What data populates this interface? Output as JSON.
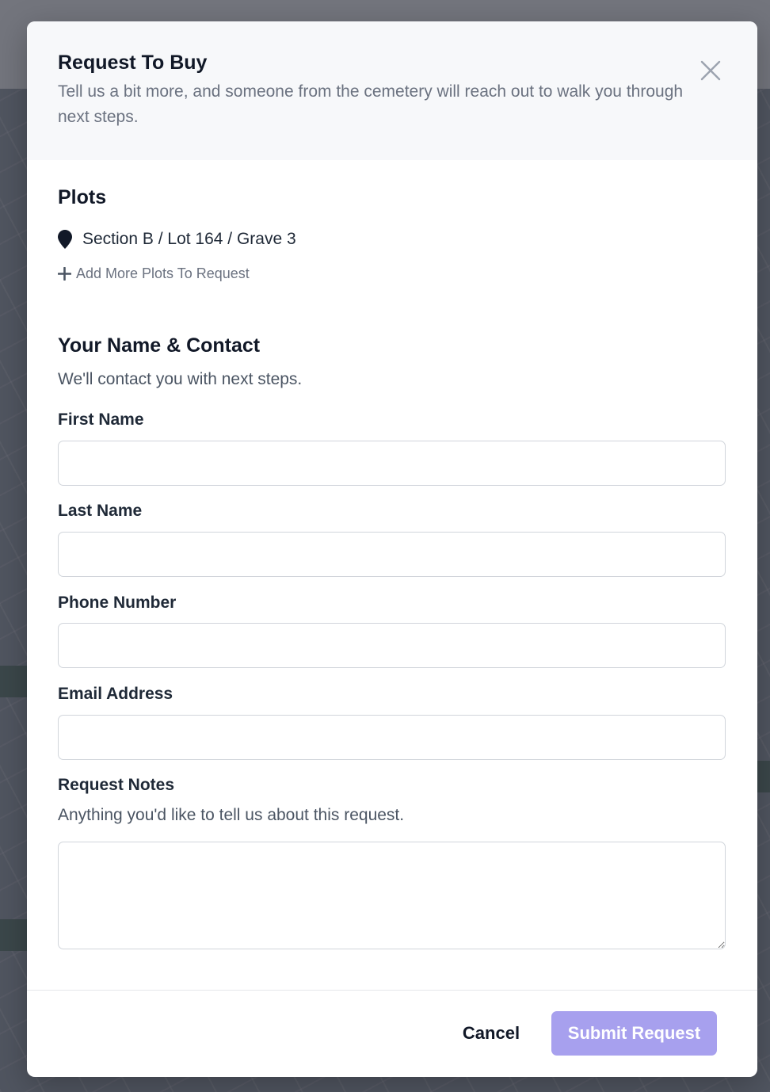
{
  "modal": {
    "title": "Request To Buy",
    "subtitle": "Tell us a bit more, and someone from the cemetery will reach out to walk you through next steps."
  },
  "plots": {
    "heading": "Plots",
    "items": [
      {
        "label": "Section B / Lot 164 / Grave 3",
        "icon": "map-pin-icon"
      }
    ],
    "add_more_label": "Add More Plots To Request"
  },
  "contact": {
    "heading": "Your Name & Contact",
    "help": "We'll contact you with next steps.",
    "first_name": {
      "label": "First Name",
      "value": ""
    },
    "last_name": {
      "label": "Last Name",
      "value": ""
    },
    "phone": {
      "label": "Phone Number",
      "value": ""
    },
    "email": {
      "label": "Email Address",
      "value": ""
    }
  },
  "notes": {
    "label": "Request Notes",
    "help": "Anything you'd like to tell us about this request.",
    "value": ""
  },
  "footer": {
    "cancel_label": "Cancel",
    "submit_label": "Submit Request"
  },
  "colors": {
    "submit_bg": "#a7a0ee",
    "header_bg": "#f7f8fa",
    "overlay": "#2a2e3a"
  }
}
